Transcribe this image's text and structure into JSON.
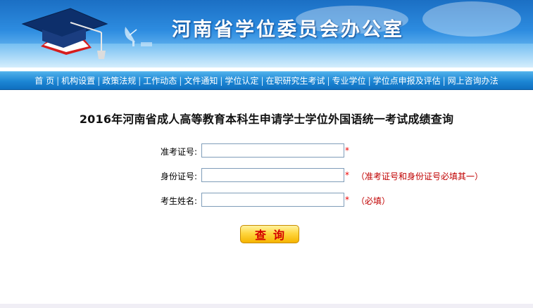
{
  "header": {
    "site_title": "河南省学位委员会办公室"
  },
  "nav": {
    "items": [
      "首 页",
      "机构设置",
      "政策法规",
      "工作动态",
      "文件通知",
      "学位认定",
      "在职研究生考试",
      "专业学位",
      "学位点申报及评估",
      "网上咨询办法"
    ],
    "separator": "|"
  },
  "main": {
    "title": "2016年河南省成人高等教育本科生申请学士学位外国语统一考试成绩查询"
  },
  "form": {
    "exam_no": {
      "label": "准考证号:",
      "value": "",
      "required_mark": "*",
      "hint": ""
    },
    "id_no": {
      "label": "身份证号:",
      "value": "",
      "required_mark": "*",
      "hint": "（准考证号和身份证号必填其一）"
    },
    "name": {
      "label": "考生姓名:",
      "value": "",
      "required_mark": "*",
      "hint": "（必填）"
    },
    "submit_label": "查询"
  },
  "colors": {
    "banner_blue": "#2d8ce0",
    "nav_blue": "#1c86d4",
    "required_red": "#e00000",
    "button_yellow": "#ffd640"
  },
  "icons": [
    "graduation-cap-logo",
    "satellite-dish-icon"
  ]
}
